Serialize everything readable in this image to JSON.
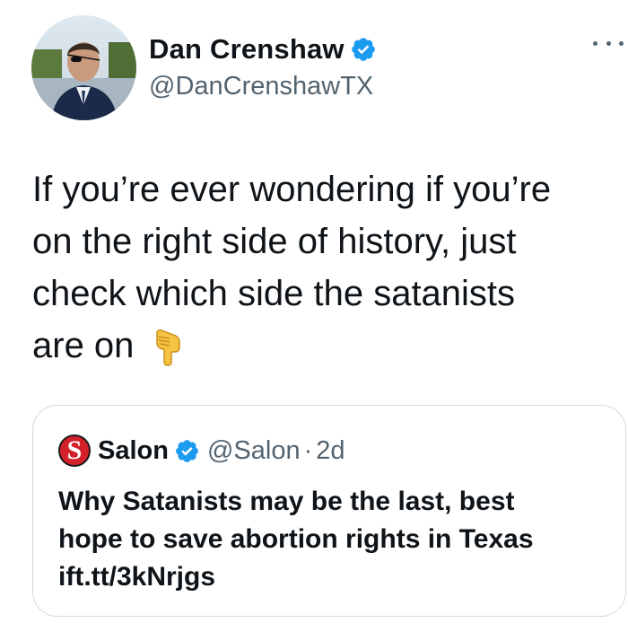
{
  "author": {
    "display_name": "Dan Crenshaw",
    "handle": "@DanCrenshawTX",
    "verified": true,
    "avatar_icon": "profile-photo"
  },
  "menu": {
    "icon": "more-options-icon"
  },
  "tweet": {
    "lines": [
      "If you’re ever wondering if you’re",
      "on the right side of history, just",
      "check which side the satanists",
      "are on"
    ],
    "emoji": "pointing-down-hand-emoji"
  },
  "quoted_tweet": {
    "logo_letter": "S",
    "display_name": "Salon",
    "verified": true,
    "handle": "@Salon",
    "separator": "·",
    "time": "2d",
    "lines": [
      "Why Satanists may be the last, best",
      "hope to save abortion rights in Texas",
      "ift.tt/3kNrjgs"
    ]
  },
  "colors": {
    "verified_blue": "#1d9bf0",
    "secondary_text": "#536471",
    "primary_text": "#0f1419",
    "border": "#cfd9de",
    "salon_red": "#d4202a"
  }
}
